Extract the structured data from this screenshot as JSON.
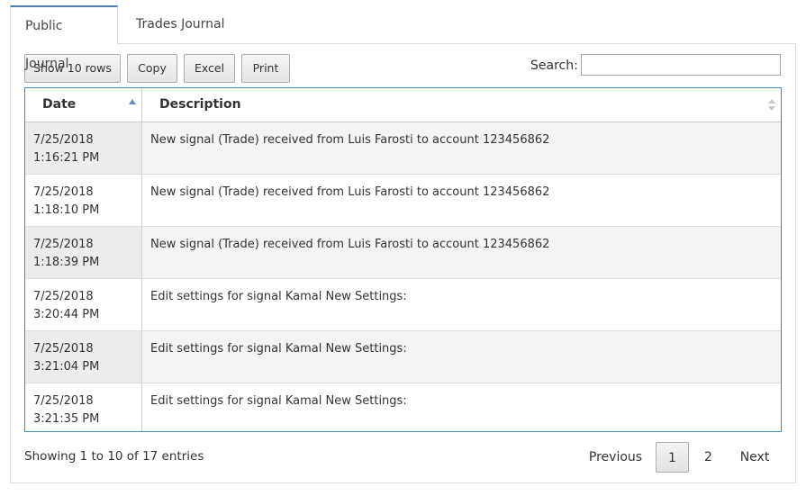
{
  "tabs": [
    {
      "label": "Public Journal",
      "active": true
    },
    {
      "label": "Trades Journal",
      "active": false
    }
  ],
  "toolbar": {
    "show_rows": "Show 10 rows",
    "copy": "Copy",
    "excel": "Excel",
    "print": "Print"
  },
  "search": {
    "label": "Search:",
    "value": ""
  },
  "table": {
    "columns": [
      "Date",
      "Description"
    ],
    "rows": [
      {
        "date": "7/25/2018",
        "time": "1:16:21 PM",
        "description": "New signal (Trade) received from Luis Farosti to account 123456862"
      },
      {
        "date": "7/25/2018",
        "time": "1:18:10 PM",
        "description": "New signal (Trade) received from Luis Farosti to account 123456862"
      },
      {
        "date": "7/25/2018",
        "time": "1:18:39 PM",
        "description": "New signal (Trade) received from Luis Farosti to account 123456862"
      },
      {
        "date": "7/25/2018",
        "time": "3:20:44 PM",
        "description": "Edit settings for signal Kamal New Settings:"
      },
      {
        "date": "7/25/2018",
        "time": "3:21:04 PM",
        "description": "Edit settings for signal Kamal New Settings:"
      },
      {
        "date": "7/25/2018",
        "time": "3:21:35 PM",
        "description": "Edit settings for signal Kamal New Settings:"
      }
    ]
  },
  "footer": {
    "info": "Showing 1 to 10 of 17 entries",
    "previous": "Previous",
    "pages": [
      "1",
      "2"
    ],
    "current_page": "1",
    "next": "Next"
  }
}
